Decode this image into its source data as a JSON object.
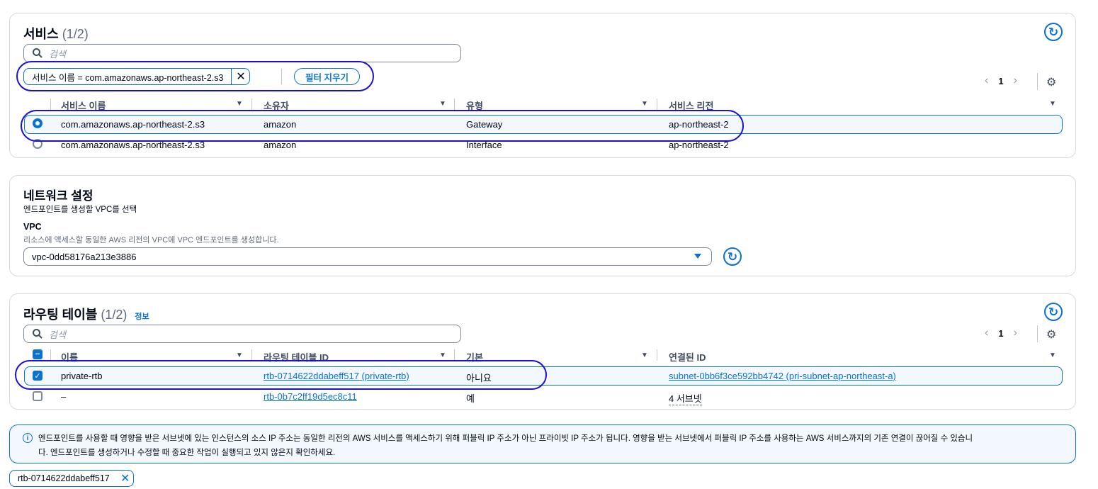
{
  "services_panel": {
    "title": "서비스",
    "count": "(1/2)",
    "search_placeholder": "검색",
    "filter_token": "서비스 이름 = com.amazonaws.ap-northeast-2.s3",
    "clear_filter_label": "필터 지우기",
    "page_number": "1",
    "columns": [
      "서비스 이름",
      "소유자",
      "유형",
      "서비스 리전"
    ],
    "rows": [
      {
        "selected": true,
        "name": "com.amazonaws.ap-northeast-2.s3",
        "owner": "amazon",
        "type": "Gateway",
        "region": "ap-northeast-2"
      },
      {
        "selected": false,
        "name": "com.amazonaws.ap-northeast-2.s3",
        "owner": "amazon",
        "type": "Interface",
        "region": "ap-northeast-2"
      }
    ]
  },
  "network_panel": {
    "title": "네트워크 설정",
    "subtitle": "엔드포인트를 생성할 VPC를 선택",
    "vpc_label": "VPC",
    "vpc_description": "리소스에 액세스할 동일한 AWS 리전의 VPC에 VPC 엔드포인트를 생성합니다.",
    "vpc_value": "vpc-0dd58176a213e3886"
  },
  "routing_panel": {
    "title": "라우팅 테이블",
    "count": "(1/2)",
    "info_label": "정보",
    "search_placeholder": "검색",
    "page_number": "1",
    "columns": [
      "이름",
      "라우팅 테이블 ID",
      "기본",
      "연결된 ID"
    ],
    "rows": [
      {
        "checked": true,
        "name": "private-rtb",
        "id": "rtb-0714622ddabeff517 (private-rtb)",
        "main": "아니요",
        "associated": "subnet-0bb6f3ce592bb4742 (pri-subnet-ap-northeast-a)"
      },
      {
        "checked": false,
        "name": "–",
        "id": "rtb-0b7c2ff19d5ec8c11",
        "main": "예",
        "associated": "4 서브넷"
      }
    ]
  },
  "alert": {
    "line1": "엔드포인트를 사용할 때 영향을 받은 서브넷에 있는 인스턴스의 소스 IP 주소는 동일한 리전의 AWS 서비스를 액세스하기 위해 퍼블릭 IP 주소가 아닌 프라이빗 IP 주소가 됩니다. 영향을 받는 서브넷에서 퍼블릭 IP 주소를 사용하는 AWS 서비스까지의 기존 연결이 끊어질 수 있습니",
    "line2": "다. 엔드포인트를 생성하거나 수정할 때 중요한 작업이 실행되고 있지 않은지 확인하세요."
  },
  "selected_token": "rtb-0714622ddabeff517",
  "colors": {
    "accent": "#0972d3",
    "annotation": "#1a11d6",
    "border": "#d5dbdb",
    "row_highlight": "#f2f8fd"
  }
}
